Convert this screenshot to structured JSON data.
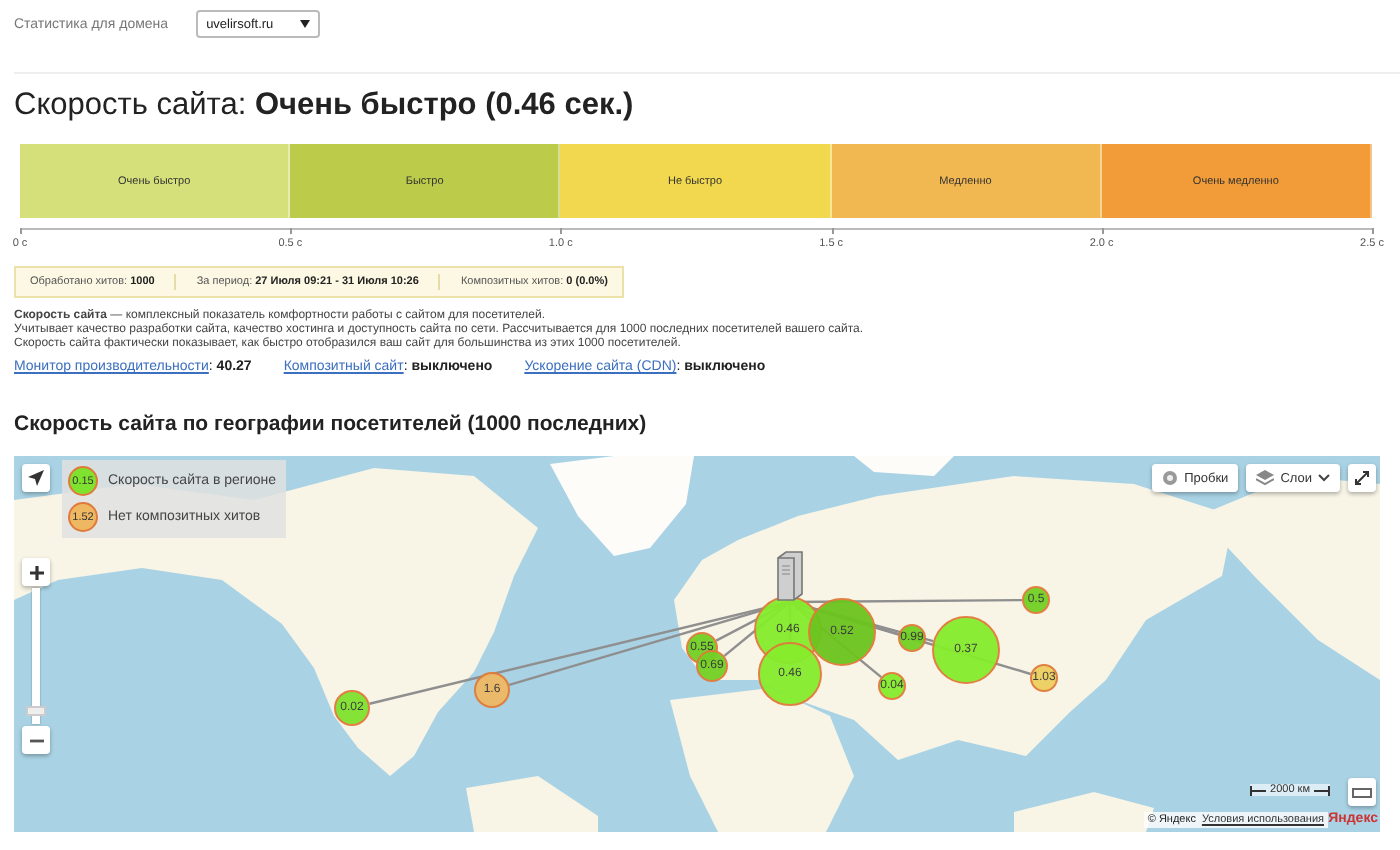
{
  "domain_filter": {
    "label": "Статистика для домена",
    "value": "uvelirsoft.ru"
  },
  "speed": {
    "label": "Скорость сайта:",
    "value": "Очень быстро (0.46 сек.)"
  },
  "speed_scale": {
    "segments": [
      {
        "label": "Очень быстро",
        "color": "#d5e07a"
      },
      {
        "label": "Быстро",
        "color": "#bccb4a"
      },
      {
        "label": "Не быстро",
        "color": "#f1d84e"
      },
      {
        "label": "Медленно",
        "color": "#f1b750"
      },
      {
        "label": "Очень медленно",
        "color": "#f19c38"
      }
    ],
    "ticks": [
      "0 с",
      "0.5 с",
      "1.0 с",
      "1.5 с",
      "2.0 с",
      "2.5 с"
    ]
  },
  "stats": [
    {
      "label": "Обработано хитов:",
      "value": "1000"
    },
    {
      "label": "За период:",
      "value": "27 Июля 09:21 - 31 Июля 10:26"
    },
    {
      "label": "Композитных хитов:",
      "value": "0 (0.0%)"
    }
  ],
  "description": [
    "**Скорость сайта** — комплексный показатель комфортности работы с сайтом для посетителей.",
    "Учитывает качество разработки сайта, качество хостинга и доступность сайта по сети. Рассчитывается для 1000 последних посетителей вашего сайта.",
    "Скорость сайта фактически показывает, как быстро отобразился ваш сайт для большинства из этих 1000 посетителей."
  ],
  "indicators": [
    {
      "link": "Монитор производительности",
      "value": ": **40.27**"
    },
    {
      "link": "Композитный сайт",
      "value": ": **выключено**"
    },
    {
      "link": "Ускорение сайта (CDN)",
      "value": ": **выключено**"
    }
  ],
  "geo_title": "Скорость сайта по географии посетителей (1000 последних)",
  "map": {
    "legend": [
      {
        "value": "0.15",
        "label": "Скорость сайта в регионе",
        "color": "#7fe22e"
      },
      {
        "value": "1.52",
        "label": "Нет композитных хитов",
        "color": "#eeb863"
      }
    ],
    "buttons": [
      {
        "label": "Пробки",
        "kind": "traffic"
      },
      {
        "label": "Слои",
        "kind": "layers"
      }
    ],
    "zoom": {
      "level": 0.1
    },
    "scale": "2000 км",
    "copyright": "© Яндекс",
    "terms_link": "Условия использования",
    "logo": "Яндекс",
    "bubbles": [
      {
        "value": "0.02",
        "color": "#7fe22e"
      },
      {
        "value": "1.6",
        "color": "#eeb863"
      },
      {
        "value": "0.55",
        "color": "#72d024"
      },
      {
        "value": "0.69",
        "color": "#72d024"
      },
      {
        "value": "0.46",
        "color": "#86ec2c"
      },
      {
        "value": "0.52",
        "color": "#6cc41e"
      },
      {
        "value": "0.99",
        "color": "#72d024"
      },
      {
        "value": "0.37",
        "color": "#86ec2c"
      },
      {
        "value": "0.5",
        "color": "#72d024"
      },
      {
        "value": "1.03",
        "color": "#eed060"
      },
      {
        "value": "0.04",
        "color": "#86ec2c"
      },
      {
        "value": "0.46",
        "color": "#86ec2c"
      }
    ]
  }
}
